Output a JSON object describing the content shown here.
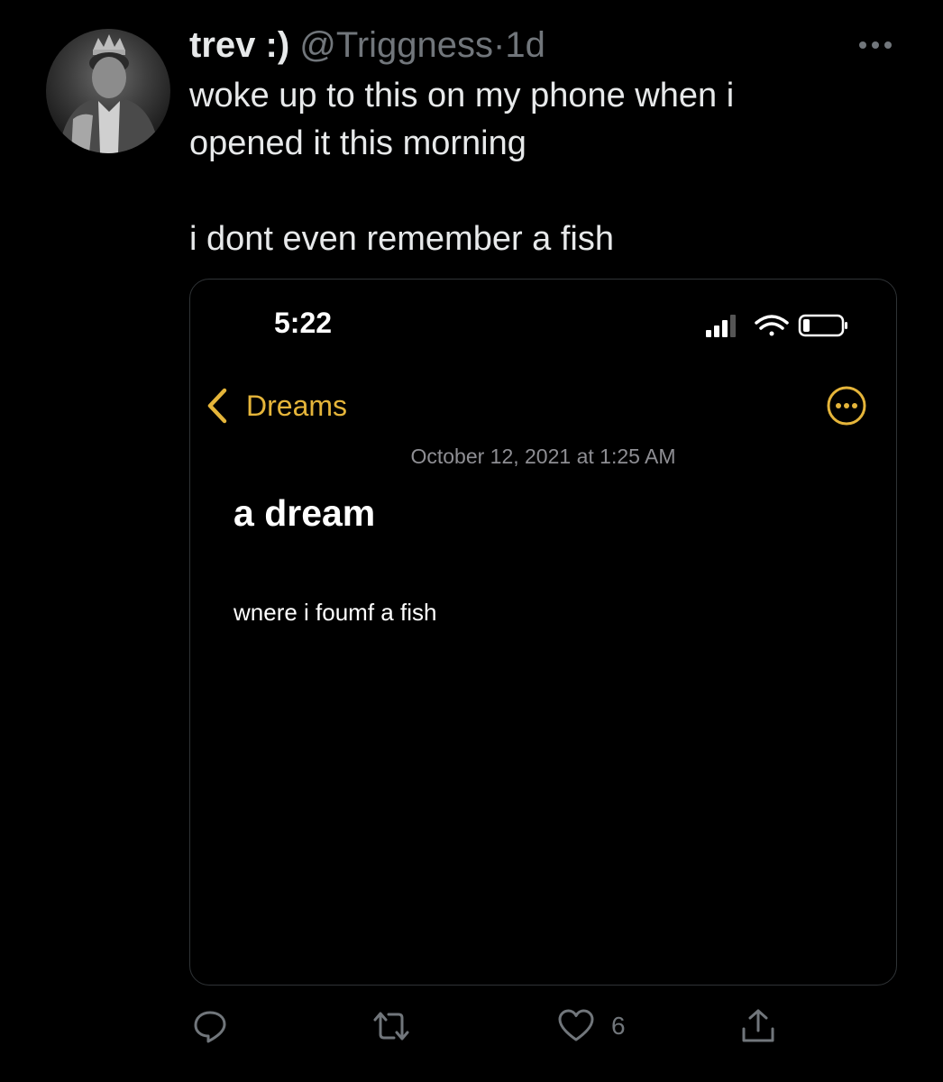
{
  "tweet": {
    "display_name": "trev :)",
    "handle": "@Triggness",
    "separator": "·",
    "time": "1d",
    "text": "woke up to this on my phone when i\nopened it this morning\n\ni dont even remember a fish"
  },
  "screenshot": {
    "status_time": "5:22",
    "back_label": "Dreams",
    "note_date": "October 12, 2021 at 1:25 AM",
    "note_title": "a dream",
    "note_body": "wnere i foumf a fish",
    "accent_color": "#e5b53a"
  },
  "actions": {
    "reply_icon": "reply-icon",
    "retweet_icon": "retweet-icon",
    "like_icon": "heart-icon",
    "like_count": "6",
    "share_icon": "share-icon"
  },
  "colors": {
    "background": "#000000",
    "text": "#e7e9ea",
    "secondary_text": "#71767b",
    "border": "#2f3336"
  }
}
